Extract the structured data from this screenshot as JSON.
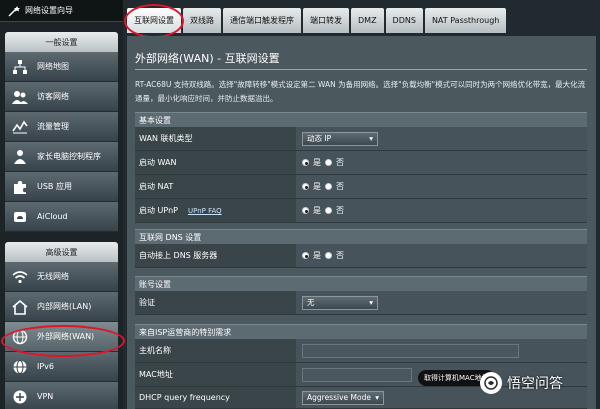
{
  "sidebar": {
    "wizard_label": "网络设置向导",
    "general_header": "一般设置",
    "general_items": [
      {
        "label": "网络地图"
      },
      {
        "label": "访客网络"
      },
      {
        "label": "流量管理"
      },
      {
        "label": "家长电脑控制程序"
      },
      {
        "label": "USB 应用"
      },
      {
        "label": "AiCloud"
      }
    ],
    "advanced_header": "高级设置",
    "advanced_items": [
      {
        "label": "无线网络"
      },
      {
        "label": "内部网络(LAN)"
      },
      {
        "label": "外部网络(WAN)"
      },
      {
        "label": "IPv6"
      },
      {
        "label": "VPN"
      }
    ]
  },
  "tabs": [
    "互联网设置",
    "双线路",
    "通信端口触发程序",
    "端口转发",
    "DMZ",
    "DDNS",
    "NAT Passthrough"
  ],
  "main": {
    "title": "外部网络(WAN) - 互联网设置",
    "description": "RT-AC68U 支持双线路。选择\"故障转移\"模式设定第二 WAN 为备用网络。选择\"负载均衡\"模式可以同时为两个网络优化带宽，最大化流通量，最小化响应时间，并防止数据溢出。",
    "basic_header": "基本设置",
    "wan_type_label": "WAN 联机类型",
    "wan_type_value": "动态 IP",
    "enable_wan_label": "启动 WAN",
    "enable_nat_label": "启动 NAT",
    "enable_upnp_label": "启动 UPnP",
    "upnp_faq": "UPnP FAQ",
    "yes": "是",
    "no": "否",
    "dns_header": "互联网 DNS 设置",
    "auto_dns_label": "自动接上 DNS 服务器",
    "account_header": "账号设置",
    "auth_label": "验证",
    "auth_value": "无",
    "isp_header": "来自ISP运营商的特别需求",
    "host_label": "主机名称",
    "mac_label": "MAC地址",
    "dhcp_label": "DHCP query frequency",
    "dhcp_value": "Aggressive Mode"
  },
  "tooltip": "取得计算机MAC地址",
  "watermark": "悟空问答",
  "colors": {
    "highlight_circle": "#e0142a"
  }
}
